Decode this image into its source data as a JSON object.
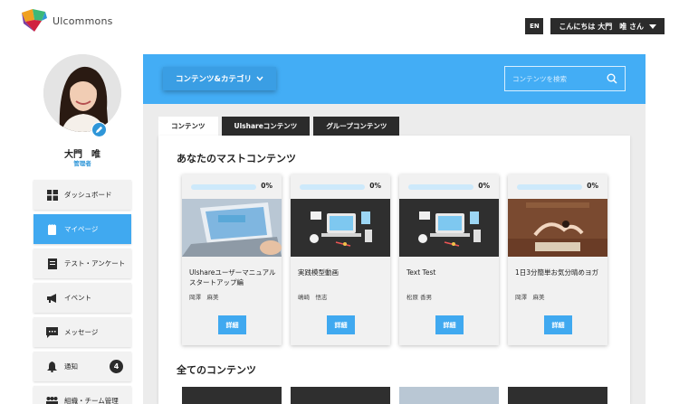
{
  "header": {
    "logo_text": "Ulcommons",
    "lang_label": "EN",
    "greeting": "こんにちは 大門　唯 さん"
  },
  "profile": {
    "name": "大門　唯",
    "role": "管理者"
  },
  "sidebar": {
    "items": [
      {
        "label": "ダッシュボード",
        "icon": "dashboard-grid-icon"
      },
      {
        "label": "マイページ",
        "icon": "notebook-icon"
      },
      {
        "label": "テスト・アンケート",
        "icon": "test-sheet-icon"
      },
      {
        "label": "イベント",
        "icon": "megaphone-icon"
      },
      {
        "label": "メッセージ",
        "icon": "chat-icon"
      },
      {
        "label": "通知",
        "icon": "bell-icon",
        "badge": "4"
      },
      {
        "label": "組織・チーム管理",
        "icon": "organization-icon"
      }
    ]
  },
  "toolbar": {
    "category_button": "コンテンツ&カテゴリ",
    "search_placeholder": "コンテンツを検索"
  },
  "tabs": [
    "コンテンツ",
    "Ulshareコンテンツ",
    "グループコンテンツ"
  ],
  "must_section": {
    "title": "あなたのマストコンテンツ",
    "cards": [
      {
        "progress_label": "0%",
        "progress": 0,
        "title": "Ulshareユーザーマニュアル　スタートアップ編",
        "author": "岡澤　麻美",
        "button": "詳細",
        "thumb": "laptop-photo"
      },
      {
        "progress_label": "0%",
        "progress": 0,
        "title": "実践模型動画",
        "author": "嶋崎　悟志",
        "button": "詳細",
        "thumb": "desk-illustration"
      },
      {
        "progress_label": "0%",
        "progress": 0,
        "title": "Text Test",
        "author": "松原 香男",
        "button": "詳細",
        "thumb": "desk-illustration"
      },
      {
        "progress_label": "0%",
        "progress": 0,
        "title": "1日3分簡単お気分晴めヨガ",
        "author": "岡澤　麻美",
        "button": "詳細",
        "thumb": "yoga-photo"
      }
    ]
  },
  "all_section": {
    "title": "全てのコンテンツ"
  },
  "colors": {
    "accent": "#40a9f0",
    "banner": "#43adf5",
    "dark": "#2b2b2b"
  }
}
